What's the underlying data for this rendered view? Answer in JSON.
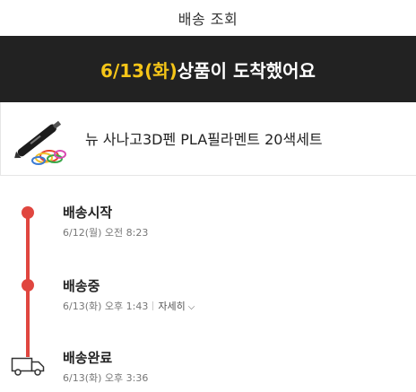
{
  "header": {
    "title": "배송 조회"
  },
  "banner": {
    "date": "6/13(화)",
    "message": "상품이 도착했어요"
  },
  "product": {
    "name": "뉴 사나고3D펜 PLA필라멘트 20색세트"
  },
  "timeline": {
    "accent_color": "#e0463f",
    "steps": [
      {
        "title": "배송시작",
        "time": "6/12(월) 오전 8:23"
      },
      {
        "title": "배송중",
        "time": "6/13(화) 오후 1:43",
        "detail_label": "자세히"
      },
      {
        "title": "배송완료",
        "time": "6/13(화) 오후 3:36"
      }
    ]
  },
  "icons": {
    "truck": "truck-icon",
    "chevron": "chevron-down-icon"
  }
}
